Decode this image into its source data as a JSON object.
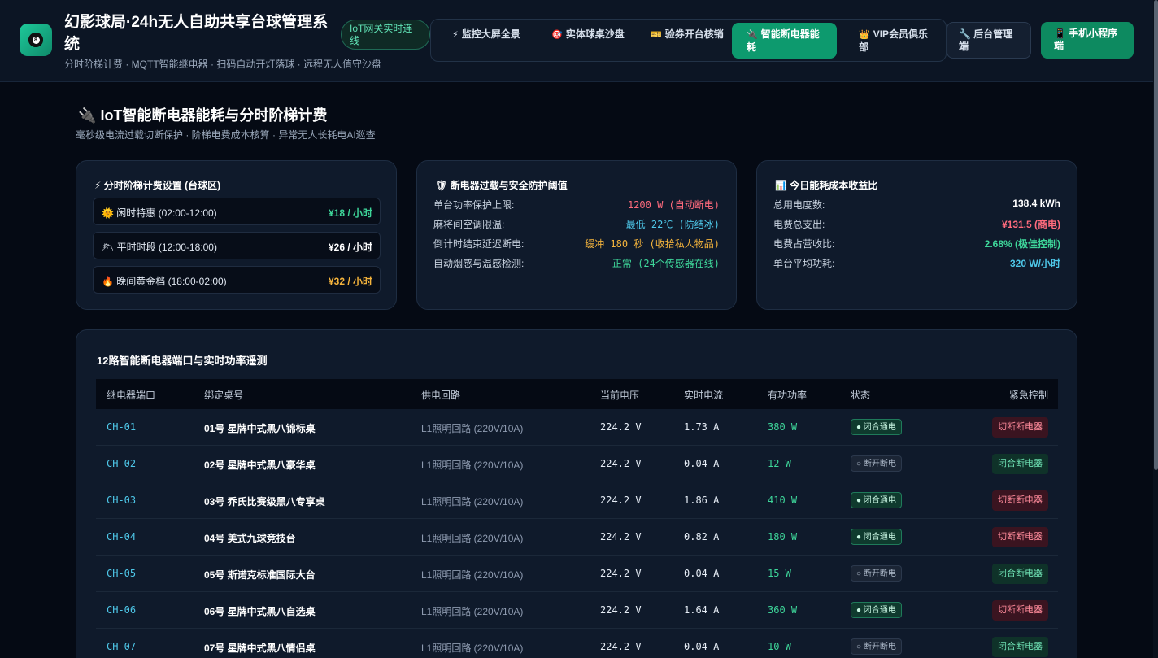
{
  "header": {
    "logo_ball": "8",
    "title": "幻影球局·24h无人自助共享台球管理系统",
    "subtitle": "分时阶梯计费 · MQTT智能继电器 · 扫码自动开灯落球 · 远程无人值守沙盘",
    "iot_badge": "IoT网关实时连线",
    "nav": [
      {
        "icon": "⚡",
        "label": "监控大屏全景"
      },
      {
        "icon": "🎯",
        "label": "实体球桌沙盘"
      },
      {
        "icon": "🎫",
        "label": "验券开台核销"
      },
      {
        "icon": "🔌",
        "label": "智能断电器能耗"
      },
      {
        "icon": "👑",
        "label": "VIP会员俱乐部"
      }
    ],
    "admin_button": {
      "icon": "🔧",
      "label": "后台管理端"
    },
    "mini_button": {
      "icon": "📱",
      "label": "手机小程序端"
    }
  },
  "section": {
    "icon": "🔌",
    "title": "IoT智能断电器能耗与分时阶梯计费",
    "subtitle": "毫秒级电流过载切断保护 · 阶梯电费成本核算 · 异常无人长耗电AI巡查"
  },
  "pricing": {
    "icon": "⚡",
    "title": "分时阶梯计费设置 (台球区)",
    "tiers": [
      {
        "icon": "🌞",
        "label": "闲时特惠 (02:00-12:00)",
        "price": "¥18 / 小时",
        "color": "#3ed69a"
      },
      {
        "icon": "🌥",
        "label": "平时时段 (12:00-18:00)",
        "price": "¥26 / 小时",
        "color": "#ffffff"
      },
      {
        "icon": "🔥",
        "label": "晚间黄金档 (18:00-02:00)",
        "price": "¥32 / 小时",
        "color": "#f5b43c"
      }
    ]
  },
  "protection": {
    "icon": "🛡",
    "title": "断电器过载与安全防护阈值",
    "items": [
      {
        "key": "单台功率保护上限:",
        "value": "1200 W (自动断电)",
        "color": "#ff6b7d"
      },
      {
        "key": "麻将间空调限温:",
        "value": "最低 22℃ (防结冰)",
        "color": "#4ec7e8"
      },
      {
        "key": "倒计时结束延迟断电:",
        "value": "缓冲 180 秒 (收拾私人物品)",
        "color": "#f5b43c"
      },
      {
        "key": "自动烟感与温感检测:",
        "value": "正常 (24个传感器在线)",
        "color": "#3ed69a"
      }
    ]
  },
  "energy": {
    "icon": "📊",
    "title": "今日能耗成本收益比",
    "items": [
      {
        "key": "总用电度数:",
        "value": "138.4 kWh",
        "color": "#ffffff"
      },
      {
        "key": "电费总支出:",
        "value": "¥131.5 (商电)",
        "color": "#ff6b7d"
      },
      {
        "key": "电费占营收比:",
        "value": "2.68% (极佳控制)",
        "color": "#3ed69a"
      },
      {
        "key": "单台平均功耗:",
        "value": "320 W/小时",
        "color": "#4ec7e8"
      }
    ]
  },
  "table": {
    "title": "12路智能断电器端口与实时功率遥测",
    "columns": [
      "继电器端口",
      "绑定桌号",
      "供电回路",
      "当前电压",
      "实时电流",
      "有功功率",
      "状态",
      "紧急控制"
    ],
    "rows": [
      {
        "port": "CH-01",
        "desk": "01号 星牌中式黑八锦标桌",
        "circuit": "L1照明回路 (220V/10A)",
        "voltage": "224.2 V",
        "current": "1.73 A",
        "power": "380 W",
        "status": "● 闭合通电",
        "on": true,
        "action": "切断断电器"
      },
      {
        "port": "CH-02",
        "desk": "02号 星牌中式黑八豪华桌",
        "circuit": "L1照明回路 (220V/10A)",
        "voltage": "224.2 V",
        "current": "0.04 A",
        "power": "12 W",
        "status": "○ 断开断电",
        "on": false,
        "action": "闭合断电器"
      },
      {
        "port": "CH-03",
        "desk": "03号 乔氏比赛级黑八专享桌",
        "circuit": "L1照明回路 (220V/10A)",
        "voltage": "224.2 V",
        "current": "1.86 A",
        "power": "410 W",
        "status": "● 闭合通电",
        "on": true,
        "action": "切断断电器"
      },
      {
        "port": "CH-04",
        "desk": "04号 美式九球竞技台",
        "circuit": "L1照明回路 (220V/10A)",
        "voltage": "224.2 V",
        "current": "0.82 A",
        "power": "180 W",
        "status": "● 闭合通电",
        "on": true,
        "action": "切断断电器"
      },
      {
        "port": "CH-05",
        "desk": "05号 斯诺克标准国际大台",
        "circuit": "L1照明回路 (220V/10A)",
        "voltage": "224.2 V",
        "current": "0.04 A",
        "power": "15 W",
        "status": "○ 断开断电",
        "on": false,
        "action": "闭合断电器"
      },
      {
        "port": "CH-06",
        "desk": "06号 星牌中式黑八自选桌",
        "circuit": "L1照明回路 (220V/10A)",
        "voltage": "224.2 V",
        "current": "1.64 A",
        "power": "360 W",
        "status": "● 闭合通电",
        "on": true,
        "action": "切断断电器"
      },
      {
        "port": "CH-07",
        "desk": "07号 星牌中式黑八情侣桌",
        "circuit": "L1照明回路 (220V/10A)",
        "voltage": "224.2 V",
        "current": "0.04 A",
        "power": "10 W",
        "status": "○ 断开断电",
        "on": false,
        "action": "闭合断电器"
      }
    ]
  }
}
